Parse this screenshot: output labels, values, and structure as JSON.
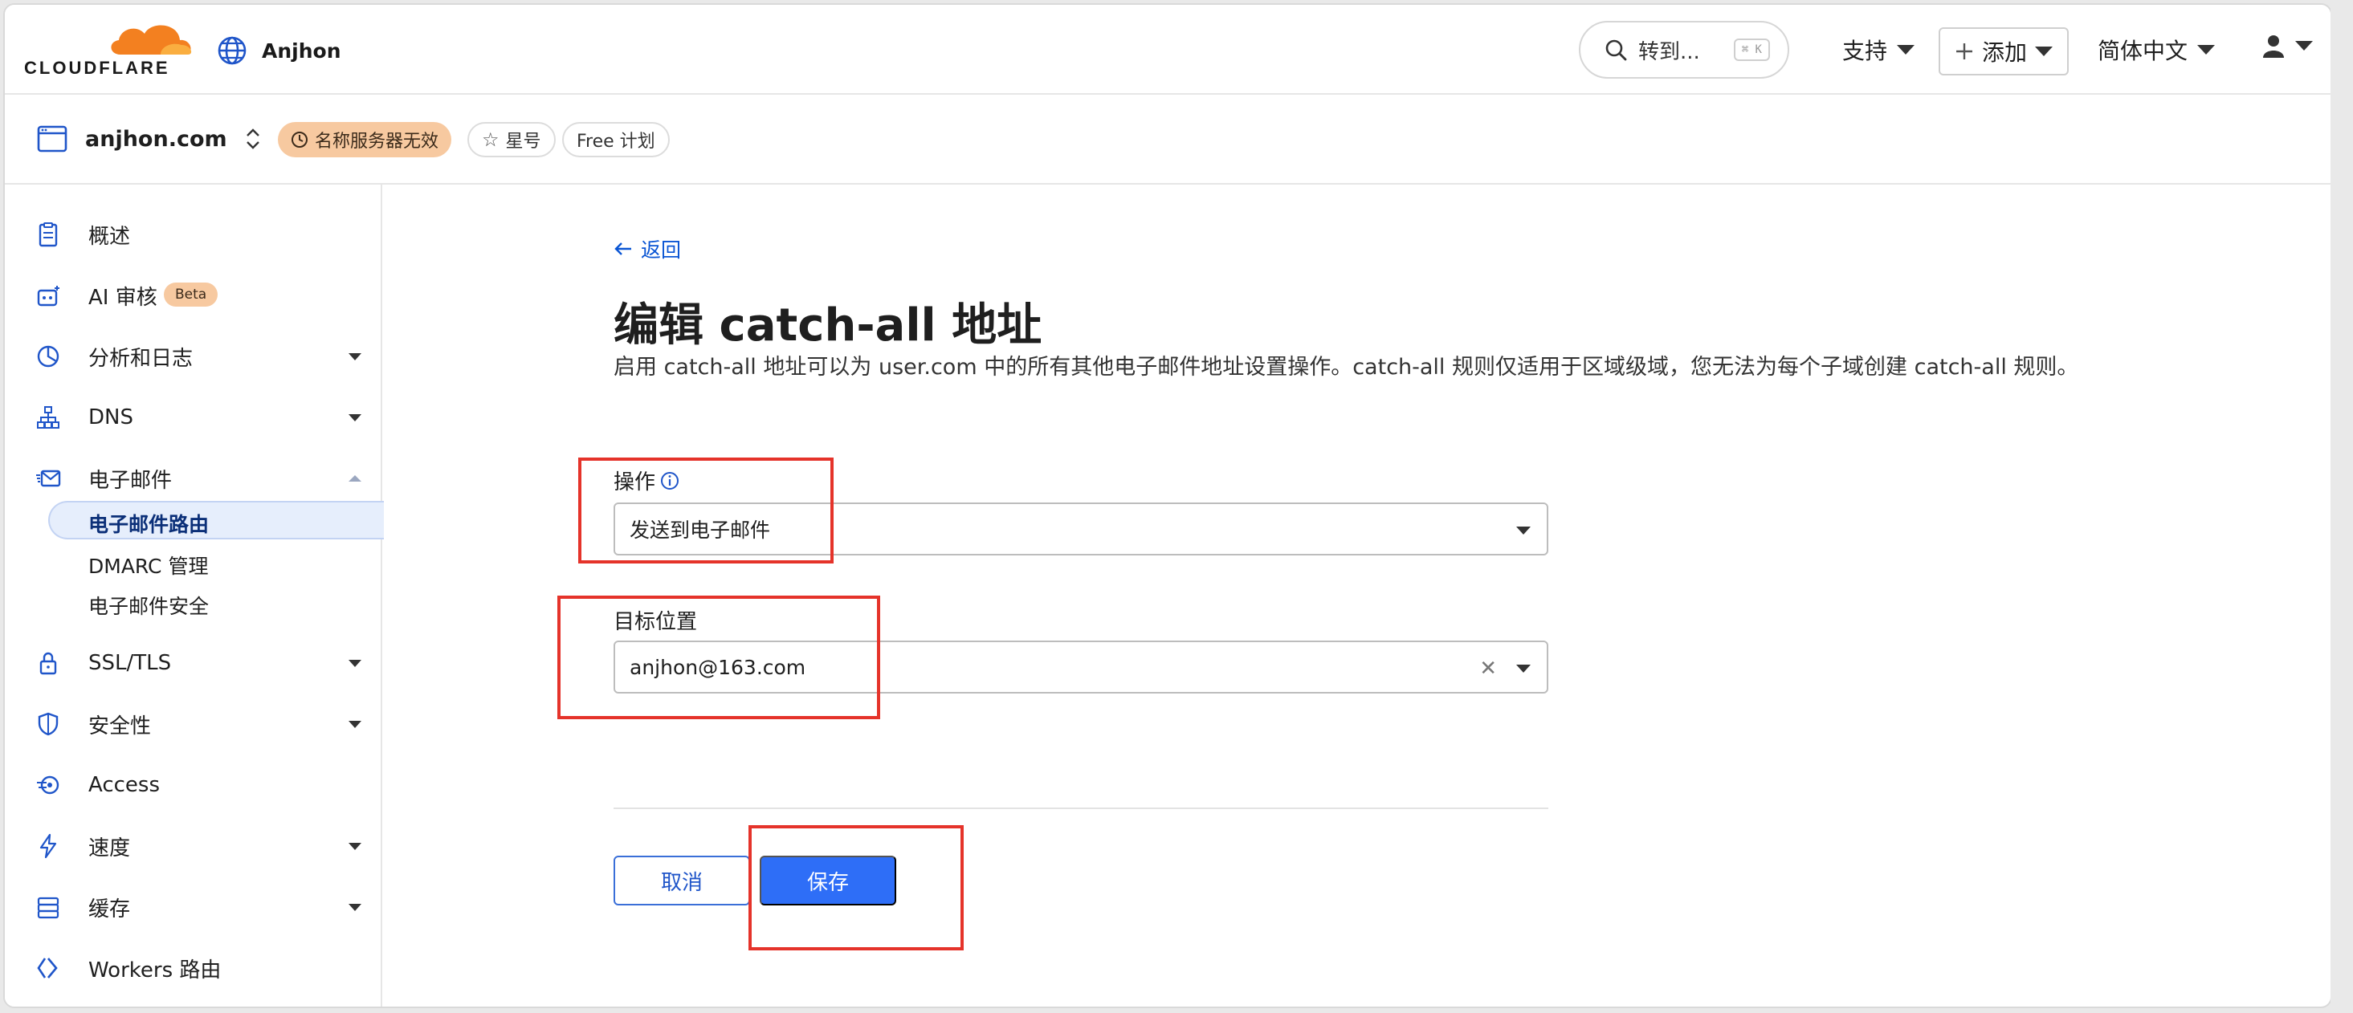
{
  "topbar": {
    "brand": "CLOUDFLARE",
    "account_name": "Anjhon",
    "search_label": "转到...",
    "search_shortcut": "⌘ K",
    "support_label": "支持",
    "add_label": "添加",
    "language_label": "简体中文"
  },
  "zonebar": {
    "domain": "anjhon.com",
    "badges": [
      "名称服务器无效",
      "星号",
      "Free 计划"
    ]
  },
  "sidebar": {
    "items": [
      {
        "label": "概述",
        "icon": "clipboard-icon"
      },
      {
        "label": "AI 审核",
        "icon": "robot-icon",
        "badge": "Beta"
      },
      {
        "label": "分析和日志",
        "icon": "chart-pie-icon"
      },
      {
        "label": "DNS",
        "icon": "network-tree-icon"
      },
      {
        "label": "电子邮件",
        "icon": "mail-icon"
      },
      {
        "label": "SSL/TLS",
        "icon": "lock-icon"
      },
      {
        "label": "安全性",
        "icon": "shield-icon"
      },
      {
        "label": "Access",
        "icon": "access-icon"
      },
      {
        "label": "速度",
        "icon": "lightning-icon"
      },
      {
        "label": "缓存",
        "icon": "server-stack-icon"
      },
      {
        "label": "Workers 路由",
        "icon": "code-brackets-icon"
      }
    ],
    "email_subitems": [
      "电子邮件路由",
      "DMARC 管理",
      "电子邮件安全"
    ]
  },
  "main": {
    "back_label": "返回",
    "title": "编辑 catch-all 地址",
    "description": "启用 catch-all 地址可以为 user.com 中的所有其他电子邮件地址设置操作。catch-all 规则仅适用于区域级域，您无法为每个子域创建 catch-all 规则。",
    "action_label": "操作",
    "action_value": "发送到电子邮件",
    "destination_label": "目标位置",
    "destination_value": "anjhon@163.com",
    "cancel_label": "取消",
    "save_label": "保存"
  },
  "colors": {
    "accent": "#2e6ef7",
    "brand_orange": "#f38020",
    "highlight_red": "#e5332a",
    "warning_badge": "#f7c9a0"
  }
}
